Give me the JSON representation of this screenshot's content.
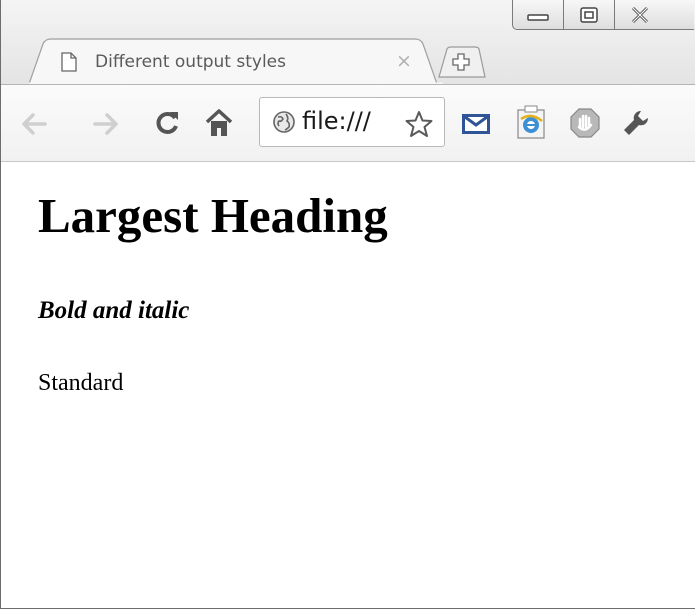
{
  "window": {
    "controls": {
      "minimize_icon": "minimize-icon",
      "maximize_icon": "restore-icon",
      "close_icon": "close-icon"
    }
  },
  "tab": {
    "title": "Different output styles",
    "close_glyph": "×"
  },
  "toolbar": {
    "address": "file:///"
  },
  "page": {
    "heading": "Largest Heading",
    "bold_italic": "Bold and italic",
    "standard": "Standard"
  },
  "colors": {
    "frame": "#e8e8e8",
    "toolbar": "#f5f5f5",
    "text": "#000000",
    "tab_text": "#5a5a5a",
    "mail_icon": "#2f5597"
  }
}
